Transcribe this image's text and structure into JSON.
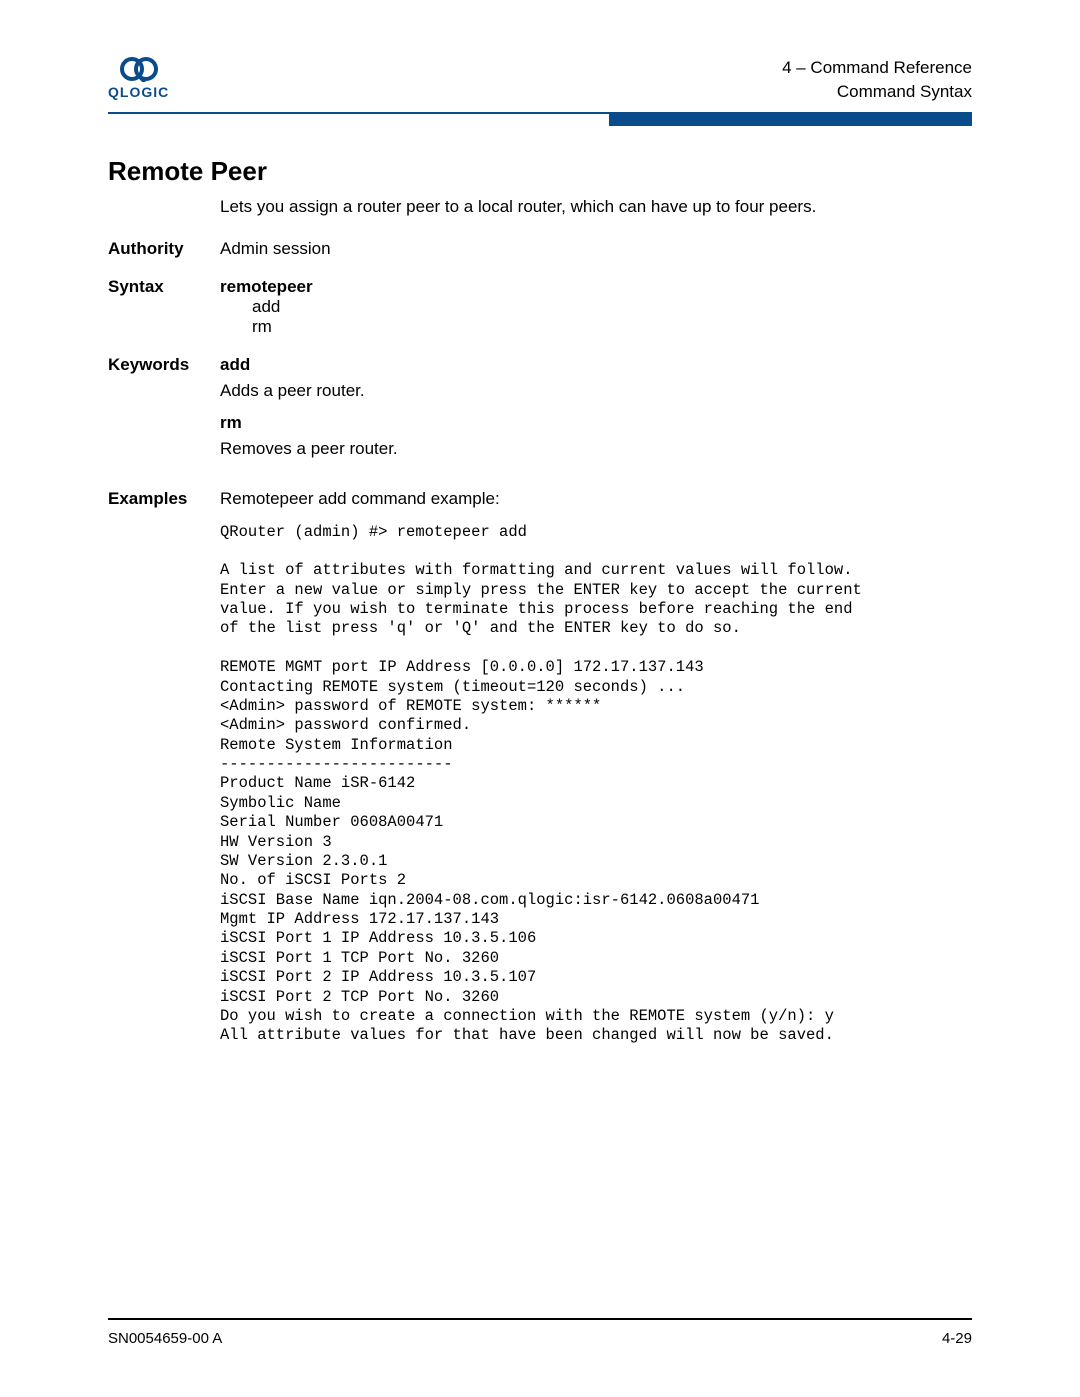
{
  "header": {
    "logo_text": "QLOGIC",
    "section_line1": "4 – Command Reference",
    "section_line2": "Command Syntax"
  },
  "title": "Remote Peer",
  "intro": "Lets you assign a router peer to a local router, which can have up to four peers.",
  "authority": {
    "label": "Authority",
    "value": "Admin session"
  },
  "syntax": {
    "label": "Syntax",
    "command": "remotepeer",
    "sub1": "add",
    "sub2": "rm"
  },
  "keywords": {
    "label": "Keywords",
    "items": [
      {
        "name": "add",
        "desc": "Adds a peer router."
      },
      {
        "name": "rm",
        "desc": "Removes a peer router."
      }
    ]
  },
  "examples": {
    "label": "Examples",
    "intro": "Remotepeer add command example:",
    "code": "QRouter (admin) #> remotepeer add\n\nA list of attributes with formatting and current values will follow.\nEnter a new value or simply press the ENTER key to accept the current\nvalue. If you wish to terminate this process before reaching the end\nof the list press 'q' or 'Q' and the ENTER key to do so.\n\nREMOTE MGMT port IP Address [0.0.0.0] 172.17.137.143\nContacting REMOTE system (timeout=120 seconds) ...\n<Admin> password of REMOTE system: ******\n<Admin> password confirmed.\nRemote System Information\n-------------------------\nProduct Name iSR-6142\nSymbolic Name\nSerial Number 0608A00471\nHW Version 3\nSW Version 2.3.0.1\nNo. of iSCSI Ports 2\niSCSI Base Name iqn.2004-08.com.qlogic:isr-6142.0608a00471\nMgmt IP Address 172.17.137.143\niSCSI Port 1 IP Address 10.3.5.106\niSCSI Port 1 TCP Port No. 3260\niSCSI Port 2 IP Address 10.3.5.107\niSCSI Port 2 TCP Port No. 3260\nDo you wish to create a connection with the REMOTE system (y/n): y\nAll attribute values for that have been changed will now be saved."
  },
  "footer": {
    "doc_id": "SN0054659-00 A",
    "page_num": "4-29"
  }
}
